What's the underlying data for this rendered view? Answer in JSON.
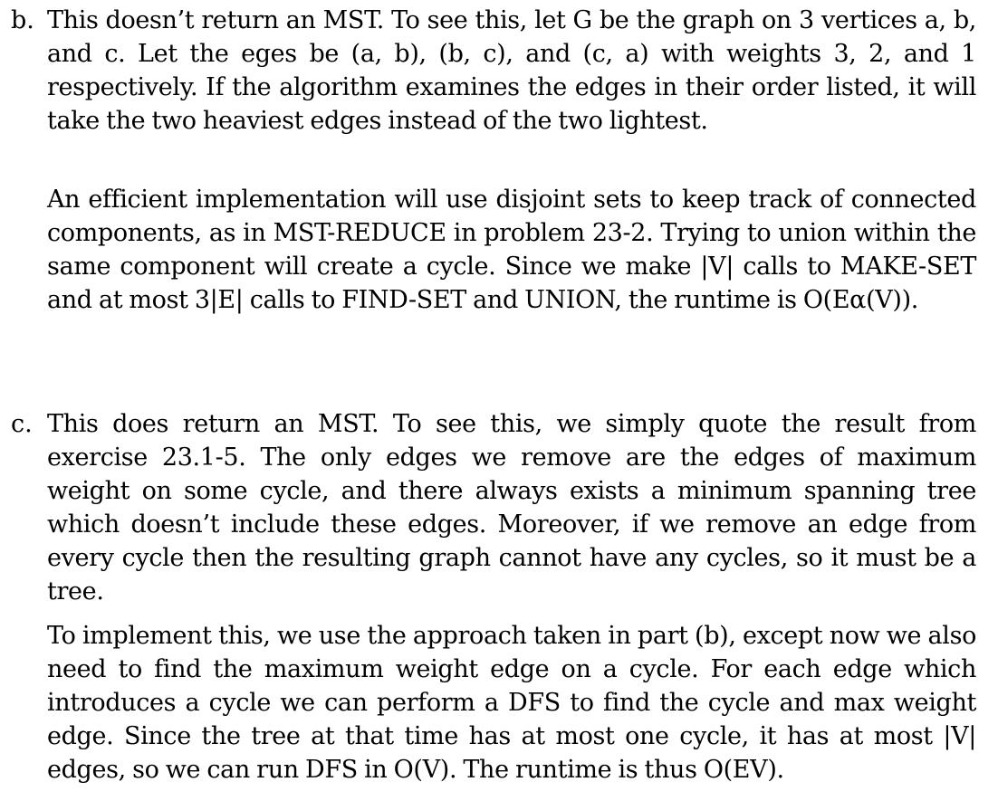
{
  "items": [
    {
      "label": "b.",
      "paragraphs": [
        "This doesn’t return an MST. To see this, let G be the graph on 3 vertices a, b, and c. Let the eges be (a, b), (b, c), and (c, a) with weights 3, 2, and 1 respectively. If the algorithm examines the edges in their order listed, it will take the two heaviest edges instead of the two lightest.",
        "An efficient implementation will use disjoint sets to keep track of connected components, as in MST-REDUCE in problem 23-2. Trying to union within the same component will create a cycle. Since we make |V| calls to MAKE-SET and at most 3|E| calls to FIND-SET and UNION, the runtime is O(Eα(V))."
      ]
    },
    {
      "label": "c.",
      "paragraphs": [
        "This does return an MST. To see this, we simply quote the result from exercise 23.1-5. The only edges we remove are the edges of maximum weight on some cycle, and there always exists a minimum spanning tree which doesn’t include these edges. Moreover, if we remove an edge from every cycle then the resulting graph cannot have any cycles, so it must be a tree.",
        "To implement this, we use the approach taken in part (b), except now we also need to find the maximum weight edge on a cycle. For each edge which introduces a cycle we can perform a DFS to find the cycle and max weight edge. Since the tree at that time has at most one cycle, it has at most |V| edges, so we can run DFS in O(V). The runtime is thus O(EV)."
      ]
    }
  ]
}
